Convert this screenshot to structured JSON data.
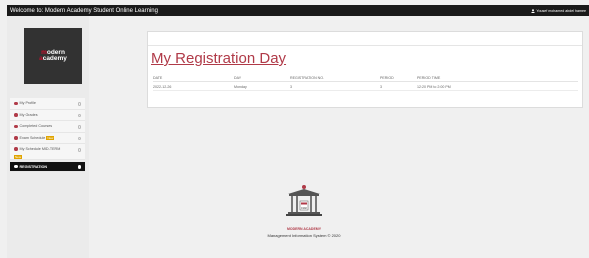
{
  "topbar": {
    "title": "Welcome to: Modern Academy Student Online Learning",
    "user": "Yousef mohamed abdel hamee"
  },
  "logo": {
    "line1_red": "m",
    "line1": "odern",
    "line2_red": "a",
    "line2": "cademy"
  },
  "sidebar": {
    "items": [
      {
        "label": "My Profile"
      },
      {
        "label": "My Grades"
      },
      {
        "label": "Completed Courses"
      },
      {
        "label": "Exam Schedule",
        "badge": "New"
      },
      {
        "label": "My Schedule MID-TERM",
        "badge": "New"
      },
      {
        "label": "REGISTRATION"
      }
    ]
  },
  "registration": {
    "heading": "My Registration Day",
    "columns": [
      "DATE",
      "DAY",
      "REGISTRATION NO.",
      "PERIOD",
      "PERIOD TIME"
    ],
    "rows": [
      [
        "2022-12-26",
        "Monday",
        "3",
        "3",
        "12:20 PM to 2:00 PM"
      ]
    ]
  },
  "footer": {
    "logo_years": "1992",
    "logo_text": "MODERN ACADEMY",
    "copyright": "Management Information System © 2020"
  }
}
